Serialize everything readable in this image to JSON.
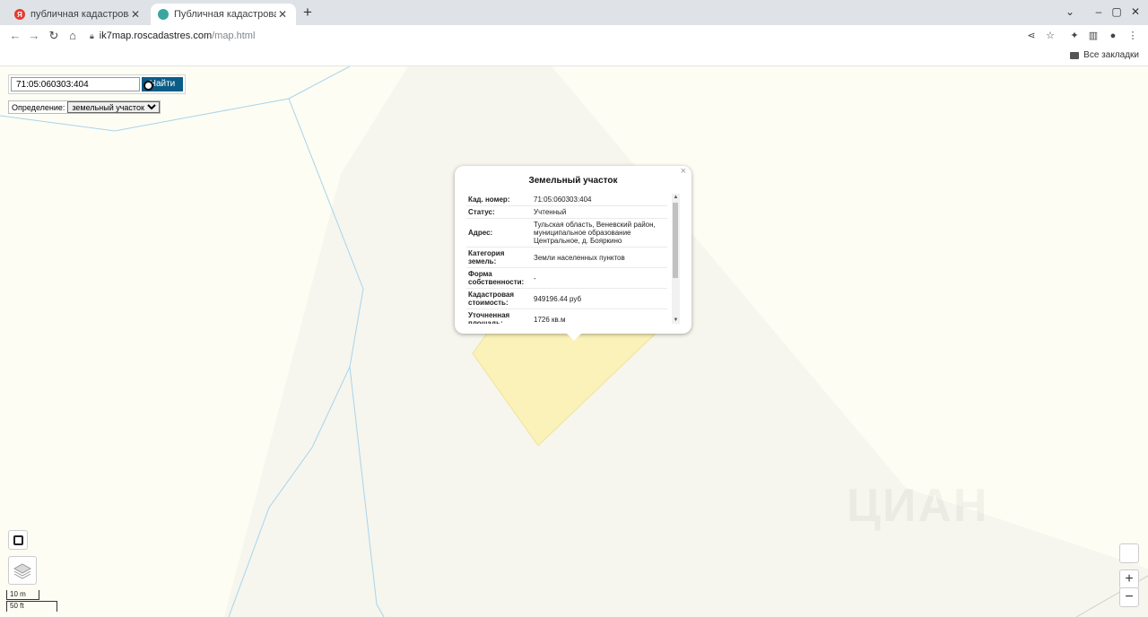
{
  "browser": {
    "tabs": [
      {
        "title": "публичная кадастровая ка",
        "favicon": "yandex-icon",
        "close": "✕"
      },
      {
        "title": "Публичная кадастровая ка",
        "favicon": "site-icon",
        "close": "✕"
      }
    ],
    "new_tab": "+",
    "url_host": "ik7map.roscadastres.com",
    "url_path": "/map.html",
    "bookmarks_label": "Все закладки"
  },
  "search": {
    "value": "71:05:060303:404",
    "button_label": "Найти",
    "definition_label": "Определение:",
    "definition_selected": "земельный участок"
  },
  "popup": {
    "title": "Земельный участок",
    "close": "×",
    "rows": [
      {
        "key": "Кад. номер:",
        "value": "71:05:060303:404"
      },
      {
        "key": "Статус:",
        "value": "Учтенный"
      },
      {
        "key": "Адрес:",
        "value": "Тульская область, Веневский район, муниципальное образование Центральное, д. Бояркино"
      },
      {
        "key": "Категория земель:",
        "value": "Земли населенных пунктов"
      },
      {
        "key": "Форма собственности:",
        "value": "-"
      },
      {
        "key": "Кадастровая стоимость:",
        "value": "949196.44 руб"
      },
      {
        "key": "Уточненная площадь:",
        "value": "1726 кв.м"
      }
    ]
  },
  "scale": {
    "metric": "10 m",
    "imperial": "50 ft"
  },
  "zoom": {
    "in": "+",
    "out": "−"
  },
  "watermark": "ЦИАН",
  "colors": {
    "parcel_fill": "#faf2b8",
    "search_button": "#0a5d87",
    "river": "#a9d3ec"
  }
}
